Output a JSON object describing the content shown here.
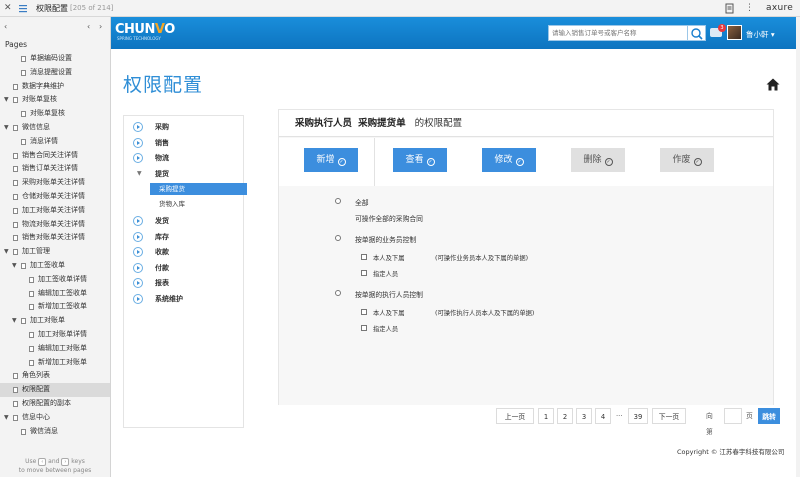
{
  "topbar": {
    "page_name": "权限配置",
    "page_count": "[205 of 214]",
    "brand": "axure"
  },
  "pages_panel": {
    "heading": "Pages",
    "hint_use": "Use",
    "hint_and": "and",
    "hint_keys": "keys",
    "hint_move": "to move between pages",
    "items": [
      {
        "label": "单据编码设置",
        "indent": 2,
        "arrow": ""
      },
      {
        "label": "消息提醒设置",
        "indent": 2,
        "arrow": ""
      },
      {
        "label": "数据字典维护",
        "indent": 1,
        "arrow": ""
      },
      {
        "label": "对账单复核",
        "indent": 1,
        "arrow": "▼"
      },
      {
        "label": "对账单复核",
        "indent": 2,
        "arrow": ""
      },
      {
        "label": "微信信息",
        "indent": 1,
        "arrow": "▼"
      },
      {
        "label": "消息详情",
        "indent": 2,
        "arrow": ""
      },
      {
        "label": "销售合同关注详情",
        "indent": 1,
        "arrow": ""
      },
      {
        "label": "销售订单关注详情",
        "indent": 1,
        "arrow": ""
      },
      {
        "label": "采购对账单关注详情",
        "indent": 1,
        "arrow": ""
      },
      {
        "label": "仓储对账单关注详情",
        "indent": 1,
        "arrow": ""
      },
      {
        "label": "加工对账单关注详情",
        "indent": 1,
        "arrow": ""
      },
      {
        "label": "物流对账单关注详情",
        "indent": 1,
        "arrow": ""
      },
      {
        "label": "销售对账单关注详情",
        "indent": 1,
        "arrow": ""
      },
      {
        "label": "加工管理",
        "indent": 1,
        "arrow": "▼"
      },
      {
        "label": "加工签收单",
        "indent": 2,
        "arrow": "▼"
      },
      {
        "label": "加工签收单详情",
        "indent": 3,
        "arrow": ""
      },
      {
        "label": "编辑加工签收单",
        "indent": 3,
        "arrow": ""
      },
      {
        "label": "新增加工签收单",
        "indent": 3,
        "arrow": ""
      },
      {
        "label": "加工对账单",
        "indent": 2,
        "arrow": "▼"
      },
      {
        "label": "加工对账单详情",
        "indent": 3,
        "arrow": ""
      },
      {
        "label": "编辑加工对账单",
        "indent": 3,
        "arrow": ""
      },
      {
        "label": "新增加工对账单",
        "indent": 3,
        "arrow": ""
      },
      {
        "label": "角色列表",
        "indent": 1,
        "arrow": ""
      },
      {
        "label": "权限配置",
        "indent": 1,
        "arrow": "",
        "selected": true
      },
      {
        "label": "权限配置的副本",
        "indent": 1,
        "arrow": ""
      },
      {
        "label": "信息中心",
        "indent": 1,
        "arrow": "▼"
      },
      {
        "label": "微信消息",
        "indent": 2,
        "arrow": ""
      }
    ]
  },
  "header": {
    "logo_a": "CHUN",
    "logo_v": "V",
    "logo_b": "O",
    "logo_sub": "SPRING TECHNOLOGY",
    "search_placeholder": "请输入销售订单号或客户名称",
    "msg_count": "3",
    "user": "鲁小軒 ▾"
  },
  "page_title": "权限配置",
  "menu": {
    "items": [
      "采购",
      "销售",
      "物流",
      "提货",
      "发货",
      "库存",
      "收款",
      "付款",
      "报表",
      "系统维护"
    ],
    "sub_items": [
      "采购提货",
      "货物入库"
    ]
  },
  "panel": {
    "title_role": "采购执行人员",
    "title_module": "采购提货单",
    "title_suffix": "的权限配置",
    "actions": [
      {
        "label": "新增",
        "state": "on"
      },
      {
        "label": "查看",
        "state": "on"
      },
      {
        "label": "修改",
        "state": "on"
      },
      {
        "label": "删除",
        "state": "off"
      },
      {
        "label": "作废",
        "state": "off"
      }
    ],
    "scope": {
      "all": "全部",
      "all_desc": "可操作全部的采购合同",
      "by_sales": "按单据的业务员控制",
      "self_sub": "本人及下属",
      "self_sub_desc_sales": "(可操作业务员本人及下属的单据)",
      "assigned": "指定人员",
      "by_exec": "按单据的执行人员控制",
      "self_sub_desc_exec": "(可操作执行人员本人及下属的单据)"
    }
  },
  "pager": {
    "prev": "上一页",
    "pages": [
      "1",
      "2",
      "3",
      "4"
    ],
    "ellipsis": "···",
    "last": "39",
    "next": "下一页",
    "goto_prefix": "向第",
    "goto_suffix": "页",
    "go": "跳转"
  },
  "footer": {
    "copyright": "Copyright © 江苏春宇科技有限公司"
  }
}
